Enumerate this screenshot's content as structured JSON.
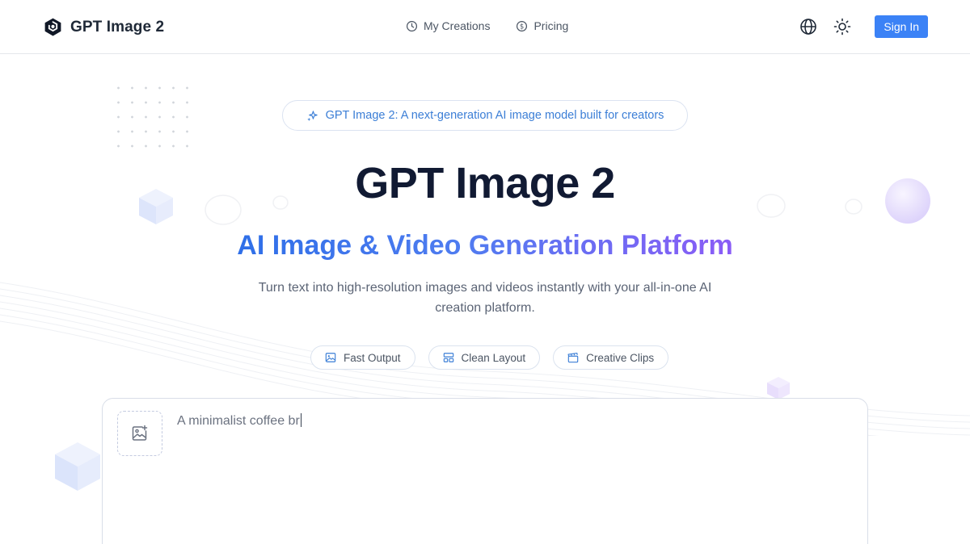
{
  "header": {
    "brand": "GPT Image 2",
    "nav": [
      {
        "label": "My Creations",
        "icon": "clock-icon"
      },
      {
        "label": "Pricing",
        "icon": "dollar-icon"
      }
    ],
    "tools": [
      "globe-icon",
      "sun-icon"
    ],
    "signin_label": "Sign In"
  },
  "hero": {
    "badge": "GPT Image 2: A next-generation AI image model built for creators",
    "title": "GPT Image 2",
    "subtitle": "AI Image & Video Generation Platform",
    "description": "Turn text into high-resolution images and videos instantly with your all-in-one AI creation platform."
  },
  "features": [
    {
      "label": "Fast Output",
      "icon": "image-icon"
    },
    {
      "label": "Clean Layout",
      "icon": "layout-icon"
    },
    {
      "label": "Creative Clips",
      "icon": "clapper-icon"
    }
  ],
  "prompt": {
    "value": "A minimalist coffee br"
  },
  "colors": {
    "accent": "#3b82f6",
    "gradient_start": "#2f6fe8",
    "gradient_end": "#8b5cf6",
    "title": "#111a33"
  }
}
